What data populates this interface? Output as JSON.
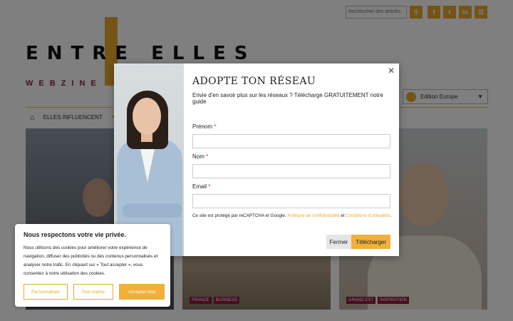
{
  "colors": {
    "accent": "#e8a92e",
    "brand": "#8b1c3d",
    "overlay": "rgba(0,0,0,0.5)"
  },
  "header": {
    "search_placeholder": "Rechercher des articles",
    "search_icon": "search-icon",
    "social_icons": [
      "facebook-icon",
      "twitter-icon",
      "linkedin-icon",
      "newsletter-icon"
    ],
    "logo_text": "ENTRE ELLES",
    "logo_subtitle": "WEBZINE",
    "edition_label": "Edition Europe"
  },
  "nav": {
    "home_icon": "home-icon",
    "items": [
      "ELLES INFLUENCENT"
    ]
  },
  "cards": [
    {
      "tags": []
    },
    {
      "tags": [
        "FRANCE",
        "BUSINESS"
      ]
    },
    {
      "tags": [
        "GRAND EST",
        "INSPIRATION"
      ]
    }
  ],
  "modal": {
    "title": "ADOPTE TON RÉSEAU",
    "intro": "Envie d'en savoir plus sur les réseaux ? Télécharge GRATUITEMENT notre guide",
    "close": "×",
    "fields": [
      {
        "label": "Prénom",
        "required": "*"
      },
      {
        "label": "Nom",
        "required": "*"
      },
      {
        "label": "Email",
        "required": "*"
      }
    ],
    "legal_before": "Ce site est protégé par reCAPTCHA et Google.",
    "legal_link1": "Politique de confidentialité",
    "legal_and": "et",
    "legal_link2": "Conditions d'utilisation",
    "legal_end": ".",
    "cancel_label": "Fermer",
    "submit_label": "Télécharger"
  },
  "cookie": {
    "title": "Nous respectons votre vie privée.",
    "text": "Nous utilisons des cookies pour améliorer votre expérience de navigation, diffuser des publicités ou des contenus personnalisés et analyser notre trafic. En cliquant sur « Tout accepter », vous consentez à notre utilisation des cookies.",
    "customize_label": "Personnaliser",
    "reject_label": "Tout rejeter",
    "accept_label": "Accepter tout"
  }
}
